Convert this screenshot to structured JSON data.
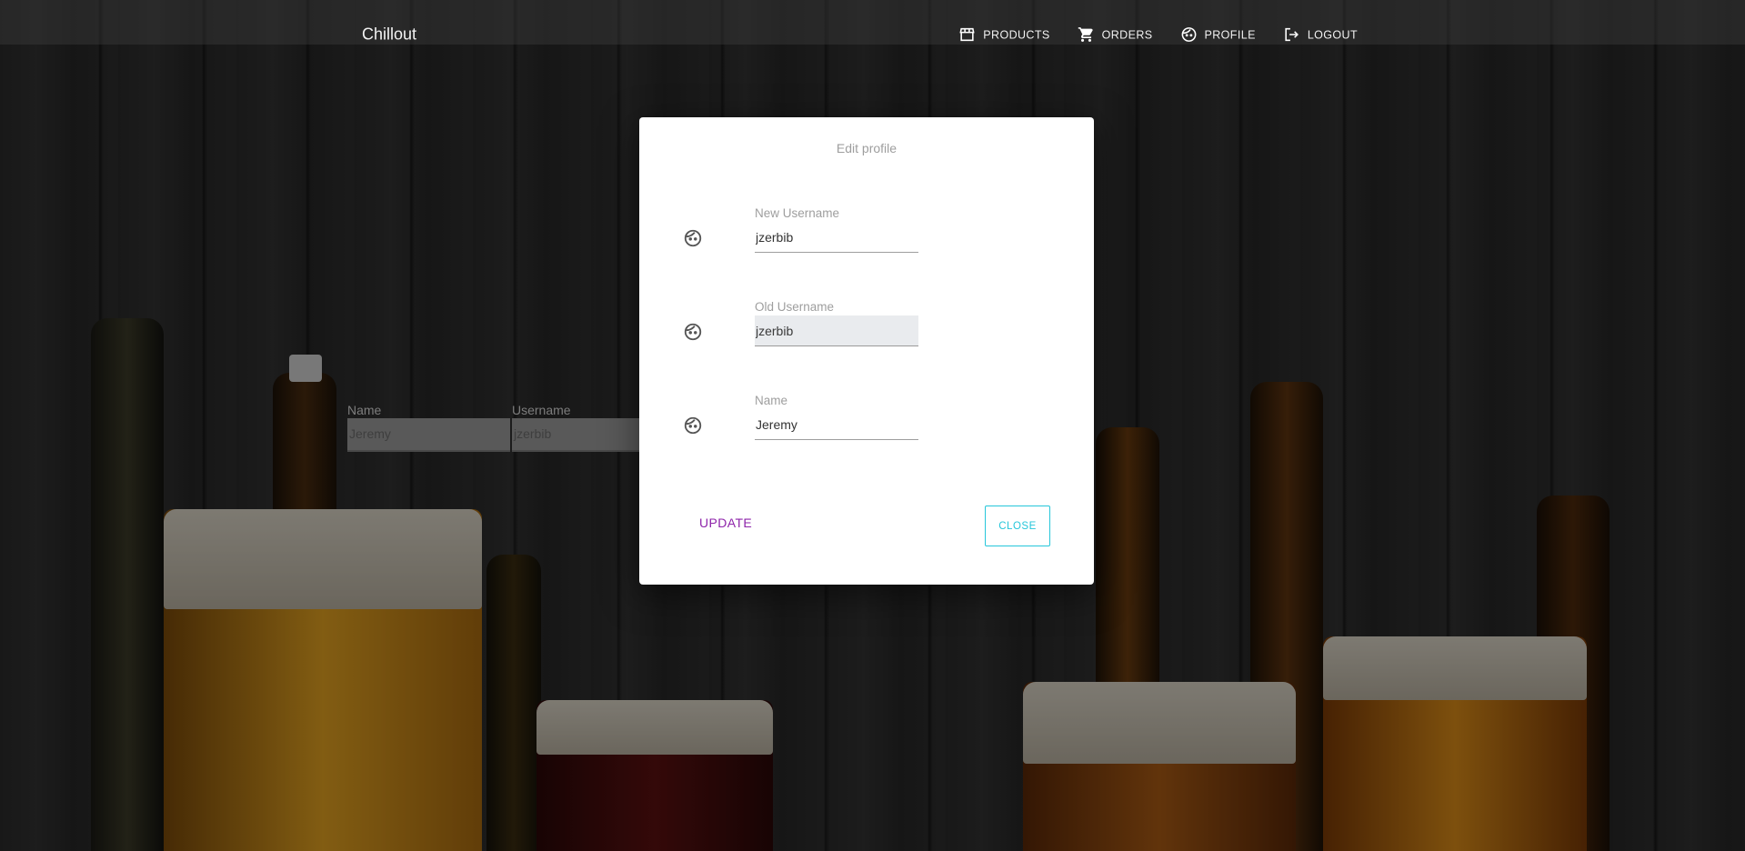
{
  "app": {
    "brand": "Chillout"
  },
  "nav": [
    {
      "label": "PRODUCTS",
      "icon": "store-icon"
    },
    {
      "label": "ORDERS",
      "icon": "cart-icon"
    },
    {
      "label": "PROFILE",
      "icon": "face-icon"
    },
    {
      "label": "LOGOUT",
      "icon": "logout-icon"
    }
  ],
  "background_form": {
    "fields": [
      {
        "label": "Name",
        "value": "Jeremy"
      },
      {
        "label": "Username",
        "value": "jzerbib"
      }
    ]
  },
  "modal": {
    "title": "Edit profile",
    "fields": [
      {
        "label": "New Username",
        "value": "jzerbib",
        "disabled": false,
        "icon": "face-icon"
      },
      {
        "label": "Old Username",
        "value": "jzerbib",
        "disabled": true,
        "icon": "face-icon"
      },
      {
        "label": "Name",
        "value": "Jeremy",
        "disabled": false,
        "icon": "face-icon"
      }
    ],
    "update_label": "UPDATE",
    "close_label": "CLOSE"
  },
  "colors": {
    "update": "#8e24aa",
    "close": "#26c6da"
  }
}
